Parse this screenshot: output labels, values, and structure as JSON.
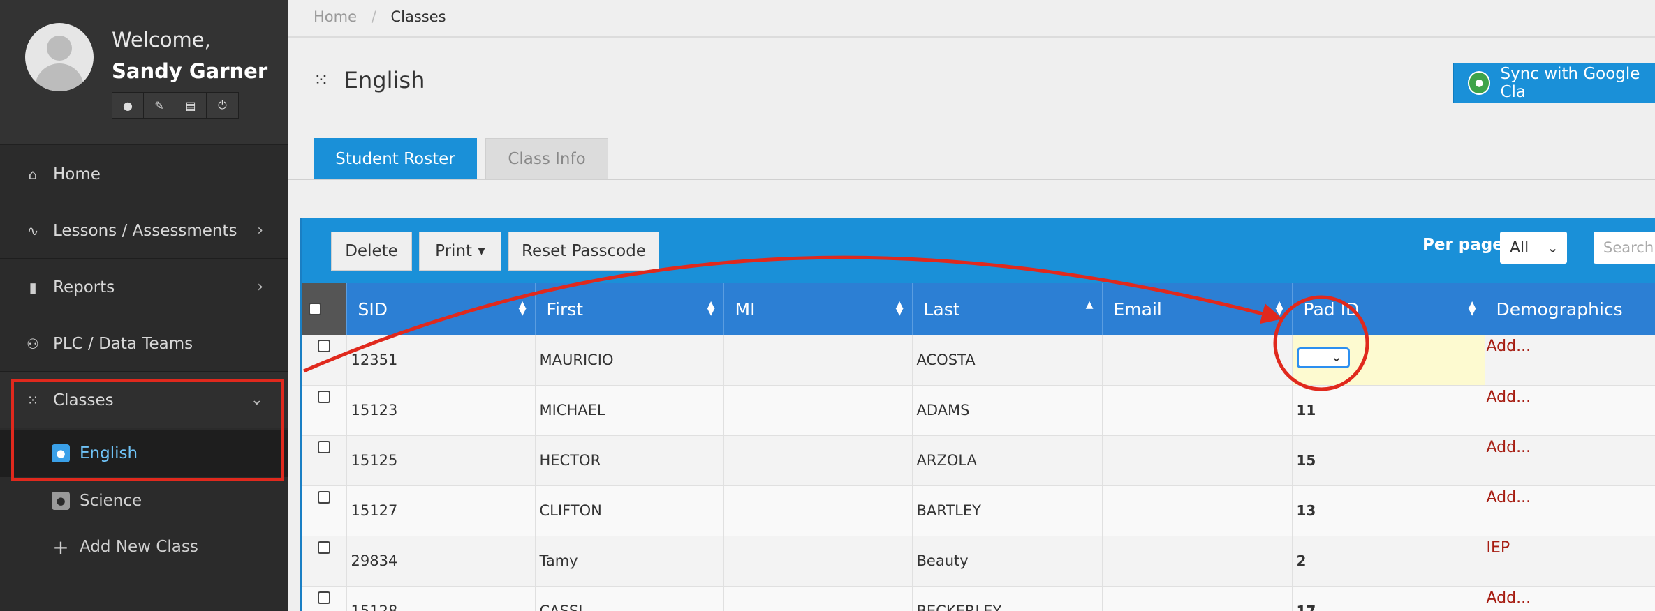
{
  "user": {
    "welcome": "Welcome,",
    "name": "Sandy Garner"
  },
  "tools": [
    "user-icon",
    "wrench-icon",
    "print-icon",
    "power-icon"
  ],
  "sidebar": {
    "items": [
      {
        "label": "Home",
        "icon": "home-icon"
      },
      {
        "label": "Lessons / Assessments",
        "icon": "pulse-icon"
      },
      {
        "label": "Reports",
        "icon": "bar-chart-icon"
      },
      {
        "label": "PLC / Data Teams",
        "icon": "group-icon"
      },
      {
        "label": "Classes",
        "icon": "grid-icon"
      }
    ],
    "sub_items": [
      {
        "label": "English"
      },
      {
        "label": "Science"
      },
      {
        "label": "Add New Class"
      }
    ]
  },
  "breadcrumb": {
    "home": "Home",
    "sep": "/",
    "current": "Classes"
  },
  "page": {
    "title": "English"
  },
  "sync_button": "Sync with Google Cla",
  "tabs": {
    "roster": "Student Roster",
    "info": "Class Info"
  },
  "toolbar": {
    "delete": "Delete",
    "print": "Print",
    "reset": "Reset Passcode",
    "per_page_label": "Per page:",
    "per_page_value": "All",
    "search_placeholder": "Search"
  },
  "table": {
    "headers": [
      "SID",
      "First",
      "MI",
      "Last",
      "Email",
      "Pad ID",
      "Demographics"
    ],
    "rows": [
      {
        "sid": "12351",
        "first": "MAURICIO",
        "mi": "",
        "last": "ACOSTA",
        "email": "",
        "pad": "",
        "demo": "Add..."
      },
      {
        "sid": "15123",
        "first": "MICHAEL",
        "mi": "",
        "last": "ADAMS",
        "email": "",
        "pad": "11",
        "demo": "Add..."
      },
      {
        "sid": "15125",
        "first": "HECTOR",
        "mi": "",
        "last": "ARZOLA",
        "email": "",
        "pad": "15",
        "demo": "Add..."
      },
      {
        "sid": "15127",
        "first": "CLIFTON",
        "mi": "",
        "last": "BARTLEY",
        "email": "",
        "pad": "13",
        "demo": "Add..."
      },
      {
        "sid": "29834",
        "first": "Tamy",
        "mi": "",
        "last": "Beauty",
        "email": "",
        "pad": "2",
        "demo": "IEP"
      },
      {
        "sid": "15128",
        "first": "CASSI",
        "mi": "",
        "last": "BECKERLEY",
        "email": "",
        "pad": "17",
        "demo": "Add..."
      }
    ]
  },
  "colors": {
    "accent": "#1a90d8",
    "header": "#2c7fd4",
    "annotation": "#e0291d",
    "link": "#a61d12"
  }
}
